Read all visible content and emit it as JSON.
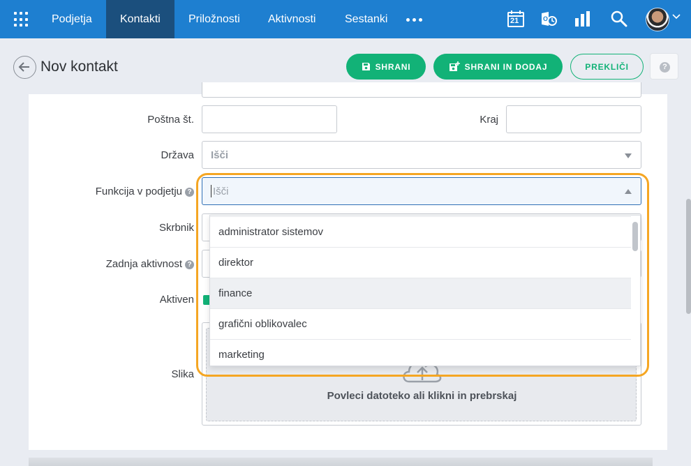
{
  "nav": {
    "items": [
      {
        "label": "Podjetja",
        "active": false
      },
      {
        "label": "Kontakti",
        "active": true
      },
      {
        "label": "Priložnosti",
        "active": false
      },
      {
        "label": "Aktivnosti",
        "active": false
      },
      {
        "label": "Sestanki",
        "active": false
      }
    ],
    "calendar_day": "21",
    "icons": [
      "apps-grid-icon",
      "more-dots-icon",
      "calendar-icon",
      "outlook-sync-icon",
      "reports-chart-icon",
      "search-icon",
      "user-avatar"
    ]
  },
  "header": {
    "title": "Nov kontakt",
    "save_label": "SHRANI",
    "save_add_label": "SHRANI IN DODAJ",
    "cancel_label": "PREKLIČI",
    "help_glyph": "?"
  },
  "form": {
    "postal_label": "Poštna št.",
    "city_label": "Kraj",
    "country_label": "Država",
    "country_placeholder": "Išči",
    "function_label": "Funkcija v podjetju",
    "function_placeholder": "Išči",
    "owner_label": "Skrbnik",
    "last_activity_label": "Zadnja aktivnost",
    "active_label": "Aktiven",
    "active_checked": true,
    "image_label": "Slika",
    "drop_text": "Povleci datoteko ali klikni in prebrskaj"
  },
  "dropdown": {
    "options": [
      "administrator sistemov",
      "direktor",
      "finance",
      "grafični oblikovalec",
      "marketing"
    ],
    "hovered_index": 2
  },
  "colors": {
    "nav_bg": "#1e7fd0",
    "nav_active": "#1b4f7d",
    "accent_green": "#12b277",
    "highlight": "#f5a623"
  }
}
